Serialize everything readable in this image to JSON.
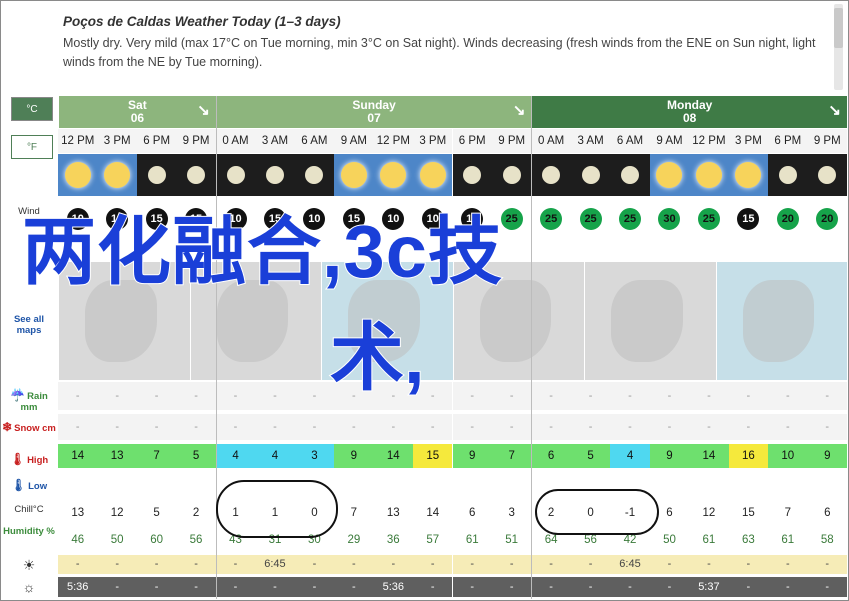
{
  "header": {
    "title": "Poços de Caldas Weather Today (1–3 days)",
    "description": "Mostly dry. Very mild (max 17°C on Tue morning, min 3°C on Sat night). Winds decreasing (fresh winds from the ENE on Sun night, light winds from the NE by Tue morning)."
  },
  "units": {
    "celsius": "°C",
    "fahrenheit": "°F"
  },
  "labels": {
    "wind": "Wind",
    "see_maps": "See all maps",
    "rain": "Rain mm",
    "snow": "Snow cm",
    "high": "High",
    "low": "Low",
    "chill": "Chill°C",
    "humidity": "Humidity %"
  },
  "days": [
    {
      "name": "Sat",
      "date": "06"
    },
    {
      "name": "Sunday",
      "date": "07"
    },
    {
      "name": "Monday",
      "date": "08"
    }
  ],
  "times": [
    "12 PM",
    "3 PM",
    "6 PM",
    "9 PM",
    "0 AM",
    "3 AM",
    "6 AM",
    "9 AM",
    "12 PM",
    "3 PM",
    "6 PM",
    "9 PM",
    "0 AM",
    "3 AM",
    "6 AM",
    "9 AM",
    "12 PM",
    "3 PM",
    "6 PM",
    "9 PM"
  ],
  "sky": [
    "day",
    "day",
    "night",
    "night",
    "night",
    "night",
    "night",
    "day",
    "day",
    "day",
    "night",
    "night",
    "night",
    "night",
    "night",
    "day",
    "day",
    "day",
    "night",
    "night"
  ],
  "wind": [
    "10",
    "15",
    "15",
    "15",
    "10",
    "15",
    "10",
    "15",
    "10",
    "10",
    "15",
    "25",
    "25",
    "25",
    "25",
    "30",
    "25",
    "15",
    "20",
    "20"
  ],
  "wind_green": [
    false,
    false,
    false,
    false,
    false,
    false,
    false,
    false,
    false,
    false,
    false,
    true,
    true,
    true,
    true,
    true,
    true,
    false,
    true,
    true
  ],
  "conditions": [
    "",
    "",
    "",
    "",
    "",
    "",
    "clear",
    "",
    "clear",
    "clear",
    "clear",
    "clear",
    "clear",
    "clear",
    "clear",
    "clear",
    "clear",
    "clear",
    "clear",
    "clear"
  ],
  "rain": [
    "-",
    "-",
    "-",
    "-",
    "-",
    "-",
    "-",
    "-",
    "-",
    "-",
    "-",
    "-",
    "-",
    "-",
    "-",
    "-",
    "-",
    "-",
    "-",
    "-"
  ],
  "snow": [
    "-",
    "-",
    "-",
    "-",
    "-",
    "-",
    "-",
    "-",
    "-",
    "-",
    "-",
    "-",
    "-",
    "-",
    "-",
    "-",
    "-",
    "-",
    "-",
    "-"
  ],
  "high": [
    "14",
    "13",
    "7",
    "5",
    "4",
    "4",
    "3",
    "9",
    "14",
    "15",
    "9",
    "7",
    "6",
    "5",
    "4",
    "9",
    "14",
    "16",
    "10",
    "9"
  ],
  "high_colors": [
    "#6ee06e",
    "#6ee06e",
    "#6ee06e",
    "#6ee06e",
    "#4fd8f0",
    "#4fd8f0",
    "#4fd8f0",
    "#6ee06e",
    "#6ee06e",
    "#f5e93c",
    "#6ee06e",
    "#6ee06e",
    "#6ee06e",
    "#6ee06e",
    "#4fd8f0",
    "#6ee06e",
    "#6ee06e",
    "#f5e93c",
    "#6ee06e",
    "#6ee06e"
  ],
  "chill": [
    "13",
    "12",
    "5",
    "2",
    "1",
    "1",
    "0",
    "7",
    "13",
    "14",
    "6",
    "3",
    "2",
    "0",
    "-1",
    "6",
    "12",
    "15",
    "7",
    "6"
  ],
  "humidity": [
    "46",
    "50",
    "60",
    "56",
    "43",
    "31",
    "30",
    "29",
    "36",
    "57",
    "61",
    "51",
    "64",
    "56",
    "42",
    "50",
    "61",
    "63",
    "61",
    "58"
  ],
  "sunrise": [
    "-",
    "-",
    "-",
    "-",
    "-",
    "6:45",
    "-",
    "-",
    "-",
    "-",
    "-",
    "-",
    "-",
    "-",
    "6:45",
    "-",
    "-",
    "-",
    "-",
    "-"
  ],
  "sunset": [
    "5:36",
    "-",
    "-",
    "-",
    "-",
    "-",
    "-",
    "-",
    "5:36",
    "-",
    "-",
    "-",
    "-",
    "-",
    "-",
    "-",
    "5:37",
    "-",
    "-",
    "-"
  ],
  "overlay": {
    "line1": "两化融合,3c技",
    "line2": "术,"
  }
}
